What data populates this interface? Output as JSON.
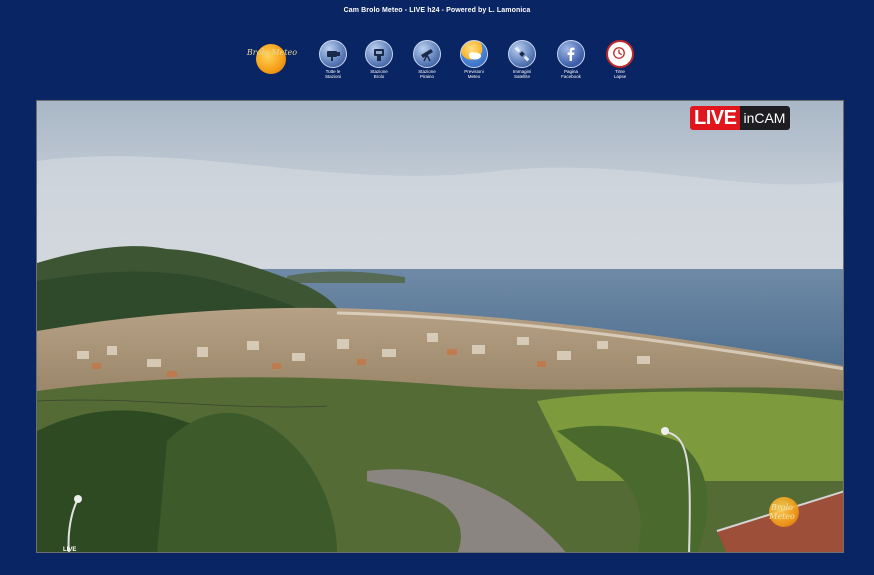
{
  "header": {
    "title": "Cam Brolo Meteo - LIVE h24 - Powered by L. Lamonica"
  },
  "logo": {
    "text": "Brolo Meteo"
  },
  "nav": [
    {
      "label": "Tutte le\nStazioni",
      "icon": "camera-icon"
    },
    {
      "label": "Stazione\nBrolo",
      "icon": "weather-station-icon"
    },
    {
      "label": "Stazione\nPiraino",
      "icon": "telescope-icon"
    },
    {
      "label": "Previsioni\nMeteo",
      "icon": "sun-cloud-icon"
    },
    {
      "label": "Immagini\nSatellite",
      "icon": "satellite-icon"
    },
    {
      "label": "Pagina\nFacebook",
      "icon": "facebook-icon"
    },
    {
      "label": "Time\nLapse",
      "icon": "clock-icon"
    }
  ],
  "webcam": {
    "badge_live": "LIVE",
    "badge_cam": "inCAM",
    "watermark": "Brolo Meteo",
    "corner_mark": "LIVE"
  },
  "colors": {
    "background": "#0a2563",
    "live_red": "#e0161c",
    "badge_dark": "#1e1e22"
  }
}
